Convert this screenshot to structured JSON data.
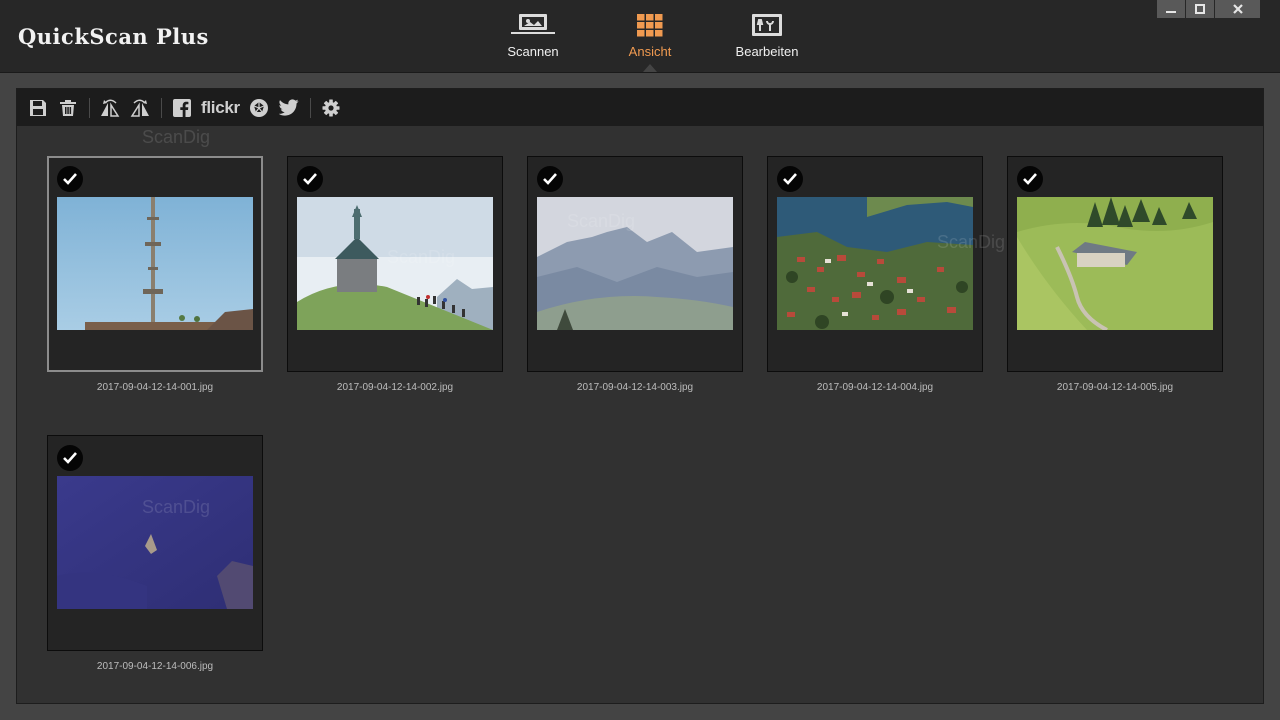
{
  "app": {
    "title": "QuickScan Plus"
  },
  "nav": {
    "tabs": [
      {
        "label": "Scannen",
        "icon": "scanner-icon",
        "active": false
      },
      {
        "label": "Ansicht",
        "icon": "grid-view-icon",
        "active": true
      },
      {
        "label": "Bearbeiten",
        "icon": "edit-tools-icon",
        "active": false
      }
    ]
  },
  "toolbar": {
    "flickr_label": "flickr",
    "icons": [
      "save-icon",
      "trash-icon",
      "rotate-left-icon",
      "rotate-right-icon",
      "facebook-icon",
      "flickr-icon",
      "picasa-icon",
      "twitter-icon",
      "gear-icon"
    ]
  },
  "watermark": "ScanDig",
  "colors": {
    "accent": "#f09a50",
    "panel": "#313131",
    "titlebar": "#272727"
  },
  "thumbnails": [
    {
      "filename": "2017-09-04-12-14-001.jpg",
      "checked": true,
      "selected": true
    },
    {
      "filename": "2017-09-04-12-14-002.jpg",
      "checked": true,
      "selected": false
    },
    {
      "filename": "2017-09-04-12-14-003.jpg",
      "checked": true,
      "selected": false
    },
    {
      "filename": "2017-09-04-12-14-004.jpg",
      "checked": true,
      "selected": false
    },
    {
      "filename": "2017-09-04-12-14-005.jpg",
      "checked": true,
      "selected": false
    },
    {
      "filename": "2017-09-04-12-14-006.jpg",
      "checked": true,
      "selected": false
    }
  ]
}
